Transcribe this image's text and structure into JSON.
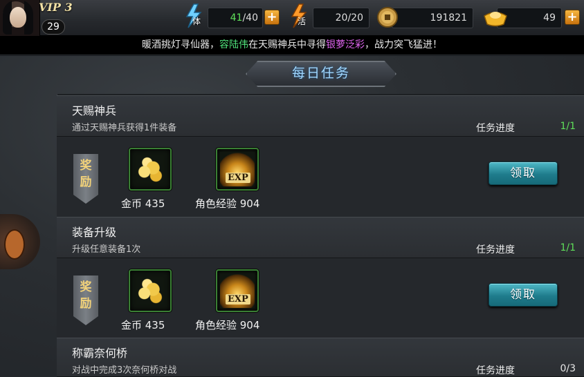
{
  "player": {
    "vip_label": "VIP 3",
    "level": "29"
  },
  "resources": {
    "stamina": {
      "glyph": "体",
      "value": "41",
      "max": "/40"
    },
    "energy": {
      "glyph": "活",
      "value": "20/20"
    },
    "coins": {
      "value": "191821"
    },
    "gold_ingots": {
      "value": "49"
    }
  },
  "marquee": {
    "part1": "暖酒挑灯寻仙器，",
    "name": "容陆伟",
    "part2": "在天赐神兵中寻得",
    "item": "银萝泛彩",
    "part3": "，战力突飞猛进！"
  },
  "title": "每日任务",
  "tasks": [
    {
      "name": "天赐神兵",
      "desc": "通过天赐神兵获得1件装备",
      "progress_label": "任务进度",
      "progress": "1/1",
      "badge": "奖励",
      "rewards": [
        "金币 435",
        "角色经验 904"
      ],
      "claim": "领取"
    },
    {
      "name": "装备升级",
      "desc": "升级任意装备1次",
      "progress_label": "任务进度",
      "progress": "1/1",
      "badge": "奖励",
      "rewards": [
        "金币 435",
        "角色经验 904"
      ],
      "claim": "领取"
    },
    {
      "name": "称霸奈何桥",
      "desc": "对战中完成3次奈何桥对战",
      "progress_label": "任务进度",
      "progress": "0/3"
    }
  ],
  "icons": {
    "exp_text": "EXP"
  },
  "colors": {
    "done": "#5fe05a",
    "accent": "#9fd7ff",
    "button": "#1f7c8c"
  }
}
